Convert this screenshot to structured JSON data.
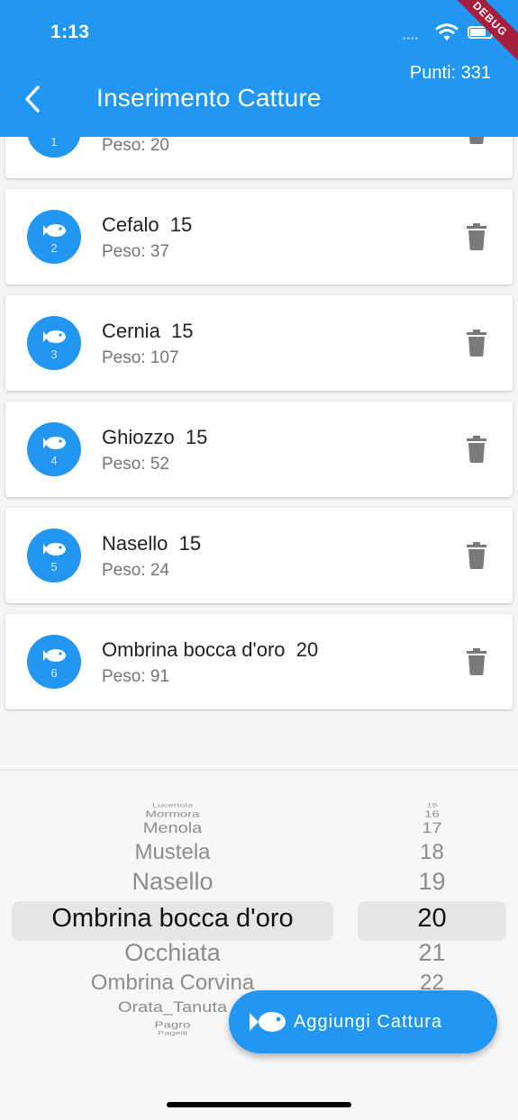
{
  "status_bar": {
    "time": "1:13"
  },
  "debug_banner": "DEBUG",
  "app_bar": {
    "title": "Inserimento Catture",
    "points": "Punti: 331"
  },
  "catches": [
    {
      "number": "1",
      "title": "",
      "weight": "Peso: 20"
    },
    {
      "number": "2",
      "title": "Cefalo  15",
      "weight": "Peso: 37"
    },
    {
      "number": "3",
      "title": "Cernia  15",
      "weight": "Peso: 107"
    },
    {
      "number": "4",
      "title": "Ghiozzo  15",
      "weight": "Peso: 52"
    },
    {
      "number": "5",
      "title": "Nasello  15",
      "weight": "Peso: 24"
    },
    {
      "number": "6",
      "title": "Ombrina bocca d'oro  20",
      "weight": "Peso: 91"
    }
  ],
  "picker": {
    "species": [
      "Lucertola",
      "Mormora",
      "Menola",
      "Mustela",
      "Nasello",
      "Ombrina bocca d'oro",
      "Occhiata",
      "Ombrina Corvina",
      "Orata_Tanuta",
      "Pagro",
      "Pagelli"
    ],
    "species_selected": "Ombrina bocca d'oro",
    "sizes": [
      "15",
      "16",
      "17",
      "18",
      "19",
      "20",
      "21",
      "22"
    ],
    "size_selected": "20"
  },
  "fab": {
    "label": "Aggiungi Cattura"
  },
  "colors": {
    "primary": "#2196f3",
    "debug": "#a51e3c",
    "icon_grey": "#7a7a7a"
  }
}
